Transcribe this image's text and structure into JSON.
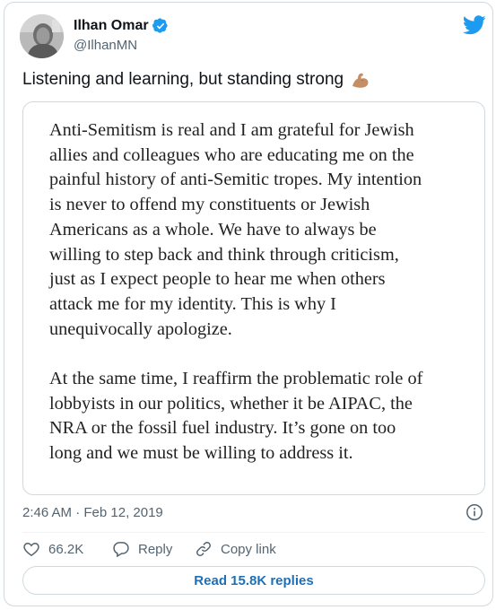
{
  "author": {
    "display_name": "Ilhan Omar",
    "handle": "@IlhanMN",
    "avatar_icon": "profile-photo",
    "verified_icon": "verified-badge-icon"
  },
  "platform_icon": "twitter-bird-icon",
  "tweet": {
    "text": "Listening and learning, but standing strong",
    "emoji_icon": "flexed-biceps-emoji"
  },
  "statement": {
    "paragraphs": [
      "Anti-Semitism is real and I am grateful for Jewish\nallies and colleagues who are educating me on the\npainful history of anti-Semitic tropes. My intention\nis never to offend my constituents or Jewish\nAmericans as a whole. We have to always be\nwilling to step back and think through criticism,\njust as I expect people to hear me when others\nattack me for my identity. This is why I\nunequivocally apologize.",
      "At the same time, I reaffirm the problematic role of\nlobbyists in our politics, whether it be AIPAC, the\nNRA or the fossil fuel industry. It’s gone on too\nlong and we must be willing to address it."
    ]
  },
  "meta": {
    "timestamp": "2:46 AM · Feb 12, 2019",
    "info_icon": "info-icon"
  },
  "actions": {
    "like_count": "66.2K",
    "reply_label": "Reply",
    "copy_link_label": "Copy link"
  },
  "replies_button": "Read 15.8K replies",
  "colors": {
    "accent": "#1d9bf0",
    "text_primary": "#0f1419",
    "text_secondary": "#536471",
    "border": "#cfd9de"
  }
}
